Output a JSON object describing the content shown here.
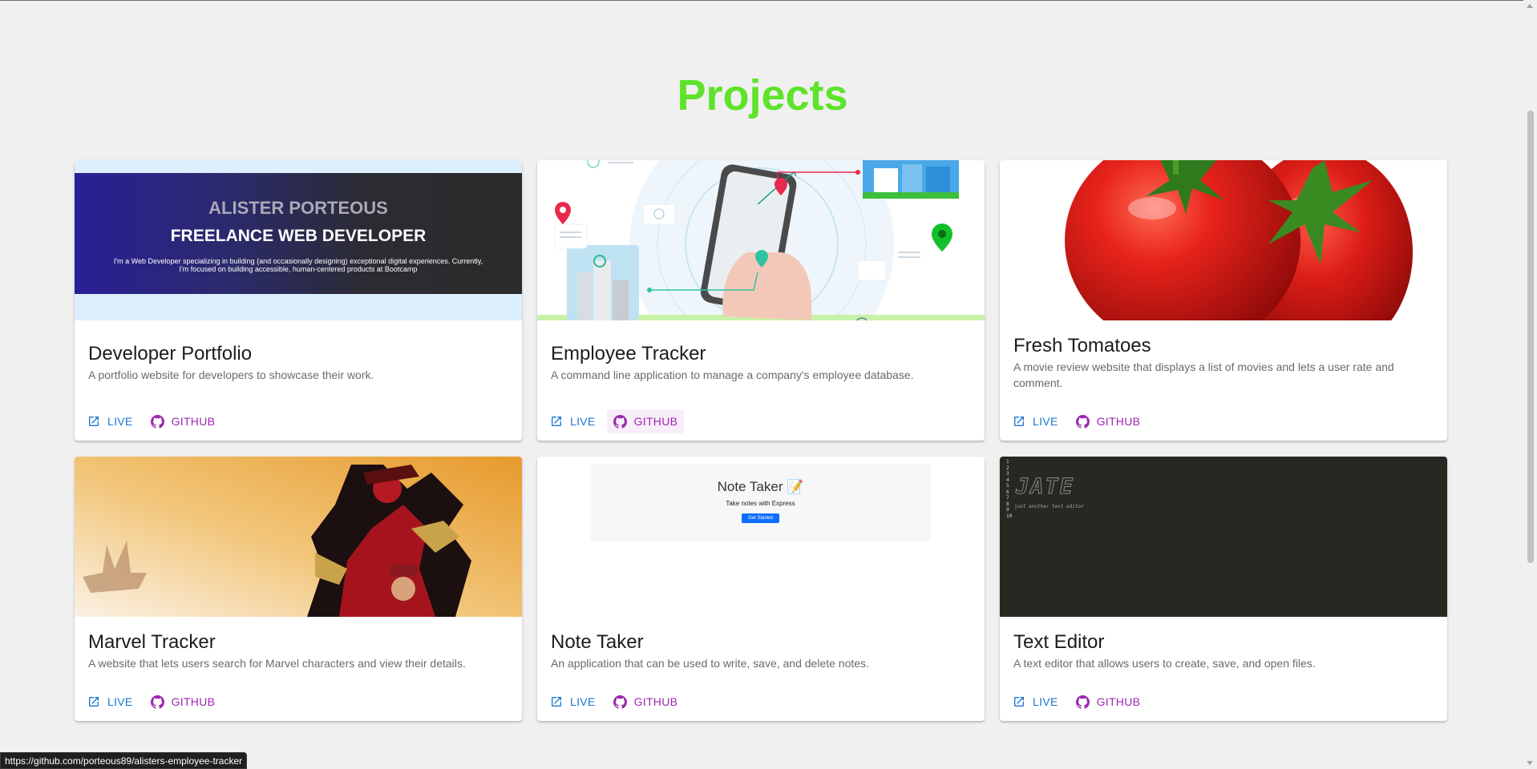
{
  "page": {
    "title": "Projects",
    "title_color": "#5ee32a",
    "background": "#f0f0f0"
  },
  "projects": [
    {
      "title": "Developer Portfolio",
      "description": "A portfolio website for developers to showcase their work.",
      "live_label": "LIVE",
      "github_label": "GITHUB",
      "media": {
        "name": "ALISTER PORTEOUS",
        "role": "FREELANCE WEB DEVELOPER",
        "blurb": "I'm a Web Developer specializing in building (and occasionally designing) exceptional digital experiences. Currently, I'm focused on building accessible, human-centered products at Bootcamp"
      }
    },
    {
      "title": "Employee Tracker",
      "description": "A command line application to manage a company's employee database.",
      "live_label": "LIVE",
      "github_label": "GITHUB"
    },
    {
      "title": "Fresh Tomatoes",
      "description": "A movie review website that displays a list of movies and lets a user rate and comment.",
      "live_label": "LIVE",
      "github_label": "GITHUB"
    },
    {
      "title": "Marvel Tracker",
      "description": "A website that lets users search for Marvel characters and view their details.",
      "live_label": "LIVE",
      "github_label": "GITHUB"
    },
    {
      "title": "Note Taker",
      "description": "An application that can be used to write, save, and delete notes.",
      "live_label": "LIVE",
      "github_label": "GITHUB",
      "media": {
        "app_title": "Note Taker",
        "subtitle": "Take notes with Express",
        "button": "Get Started"
      }
    },
    {
      "title": "Text Editor",
      "description": "A text editor that allows users to create, save, and open files.",
      "live_label": "LIVE",
      "github_label": "GITHUB",
      "media": {
        "line_numbers": "1\n2\n3\n4\n5\n6\n7\n8\n9\n10",
        "logo": "JATE",
        "tagline": "just another text editor"
      }
    }
  ],
  "status_bar": {
    "url": "https://github.com/porteous89/alisters-employee-tracker"
  },
  "colors": {
    "live": "#1976d2",
    "github": "#9c27b0",
    "card": "#ffffff"
  }
}
